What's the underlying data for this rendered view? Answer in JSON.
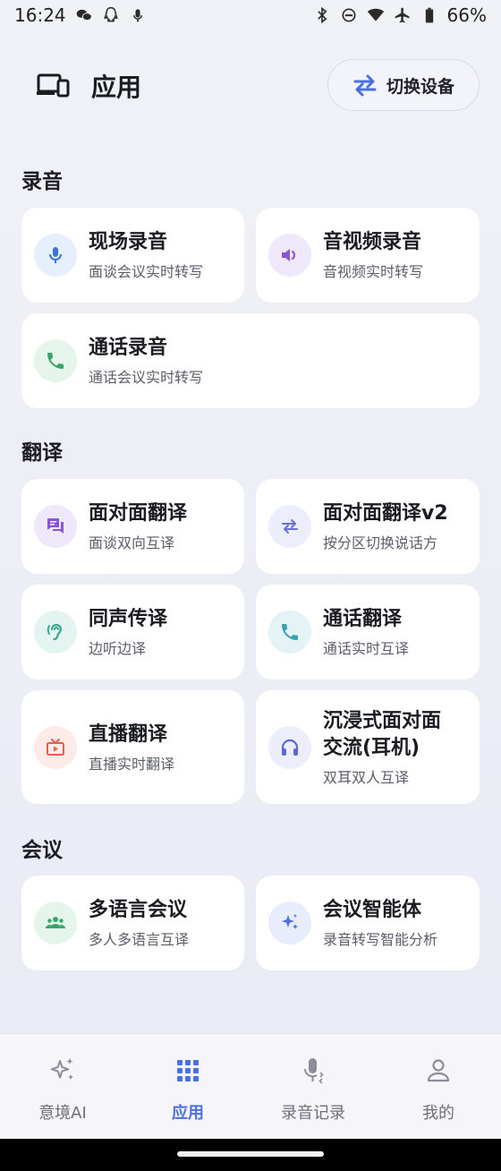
{
  "status_bar": {
    "time": "16:24",
    "battery": "66%",
    "icons_left": [
      "wechat-icon",
      "qq-icon",
      "mic-icon"
    ],
    "icons_right": [
      "bluetooth-icon",
      "dnd-icon",
      "wifi-icon",
      "airplane-icon",
      "battery-icon"
    ]
  },
  "header": {
    "title": "应用",
    "switch_device_label": "切换设备"
  },
  "sections": {
    "recording": {
      "title": "录音",
      "cards": [
        {
          "title": "现场录音",
          "subtitle": "面谈会议实时转写",
          "icon": "mic-icon",
          "color": "#3f72d8",
          "bg": "#e6effc"
        },
        {
          "title": "音视频录音",
          "subtitle": "音视频实时转写",
          "icon": "speaker-icon",
          "color": "#8a56d6",
          "bg": "#efe8fb"
        },
        {
          "title": "通话录音",
          "subtitle": "通话会议实时转写",
          "icon": "phone-icon",
          "color": "#3aa56b",
          "bg": "#e5f5ec"
        }
      ]
    },
    "translation": {
      "title": "翻译",
      "cards": [
        {
          "title": "面对面翻译",
          "subtitle": "面谈双向互译",
          "icon": "chat-icon",
          "color": "#8a56d6",
          "bg": "#efe8fb"
        },
        {
          "title": "面对面翻译v2",
          "subtitle": "按分区切换说话方",
          "icon": "swap-icon",
          "color": "#6a6fd8",
          "bg": "#eceefc"
        },
        {
          "title": "同声传译",
          "subtitle": "边听边译",
          "icon": "hearing-icon",
          "color": "#38a78f",
          "bg": "#e4f5f1"
        },
        {
          "title": "通话翻译",
          "subtitle": "通话实时互译",
          "icon": "phone-icon",
          "color": "#3a9fb0",
          "bg": "#e3f3f6"
        },
        {
          "title": "直播翻译",
          "subtitle": "直播实时翻译",
          "icon": "tv-icon",
          "color": "#e0614e",
          "bg": "#fcebe8"
        },
        {
          "title": "沉浸式面对面交流(耳机)",
          "title_line1": "沉浸式面对面",
          "title_line2": "交流(耳机)",
          "subtitle": "双耳双人互译",
          "icon": "headphones-icon",
          "color": "#5b68d6",
          "bg": "#eceefc"
        }
      ]
    },
    "meeting": {
      "title": "会议",
      "cards": [
        {
          "title": "多语言会议",
          "subtitle": "多人多语言互译",
          "icon": "group-icon",
          "color": "#3aa56b",
          "bg": "#e5f5ec"
        },
        {
          "title": "会议智能体",
          "subtitle": "录音转写智能分析",
          "icon": "sparkle-icon",
          "color": "#4a6fe0",
          "bg": "#e8edfc"
        }
      ]
    }
  },
  "bottom_nav": [
    {
      "label": "意境AI",
      "icon": "sparkle-icon",
      "active": false
    },
    {
      "label": "应用",
      "icon": "grid-icon",
      "active": true
    },
    {
      "label": "录音记录",
      "icon": "mic-icon",
      "active": false
    },
    {
      "label": "我的",
      "icon": "person-icon",
      "active": false
    }
  ],
  "colors": {
    "accent": "#4a6fe0",
    "inactive": "#8b8e99"
  }
}
